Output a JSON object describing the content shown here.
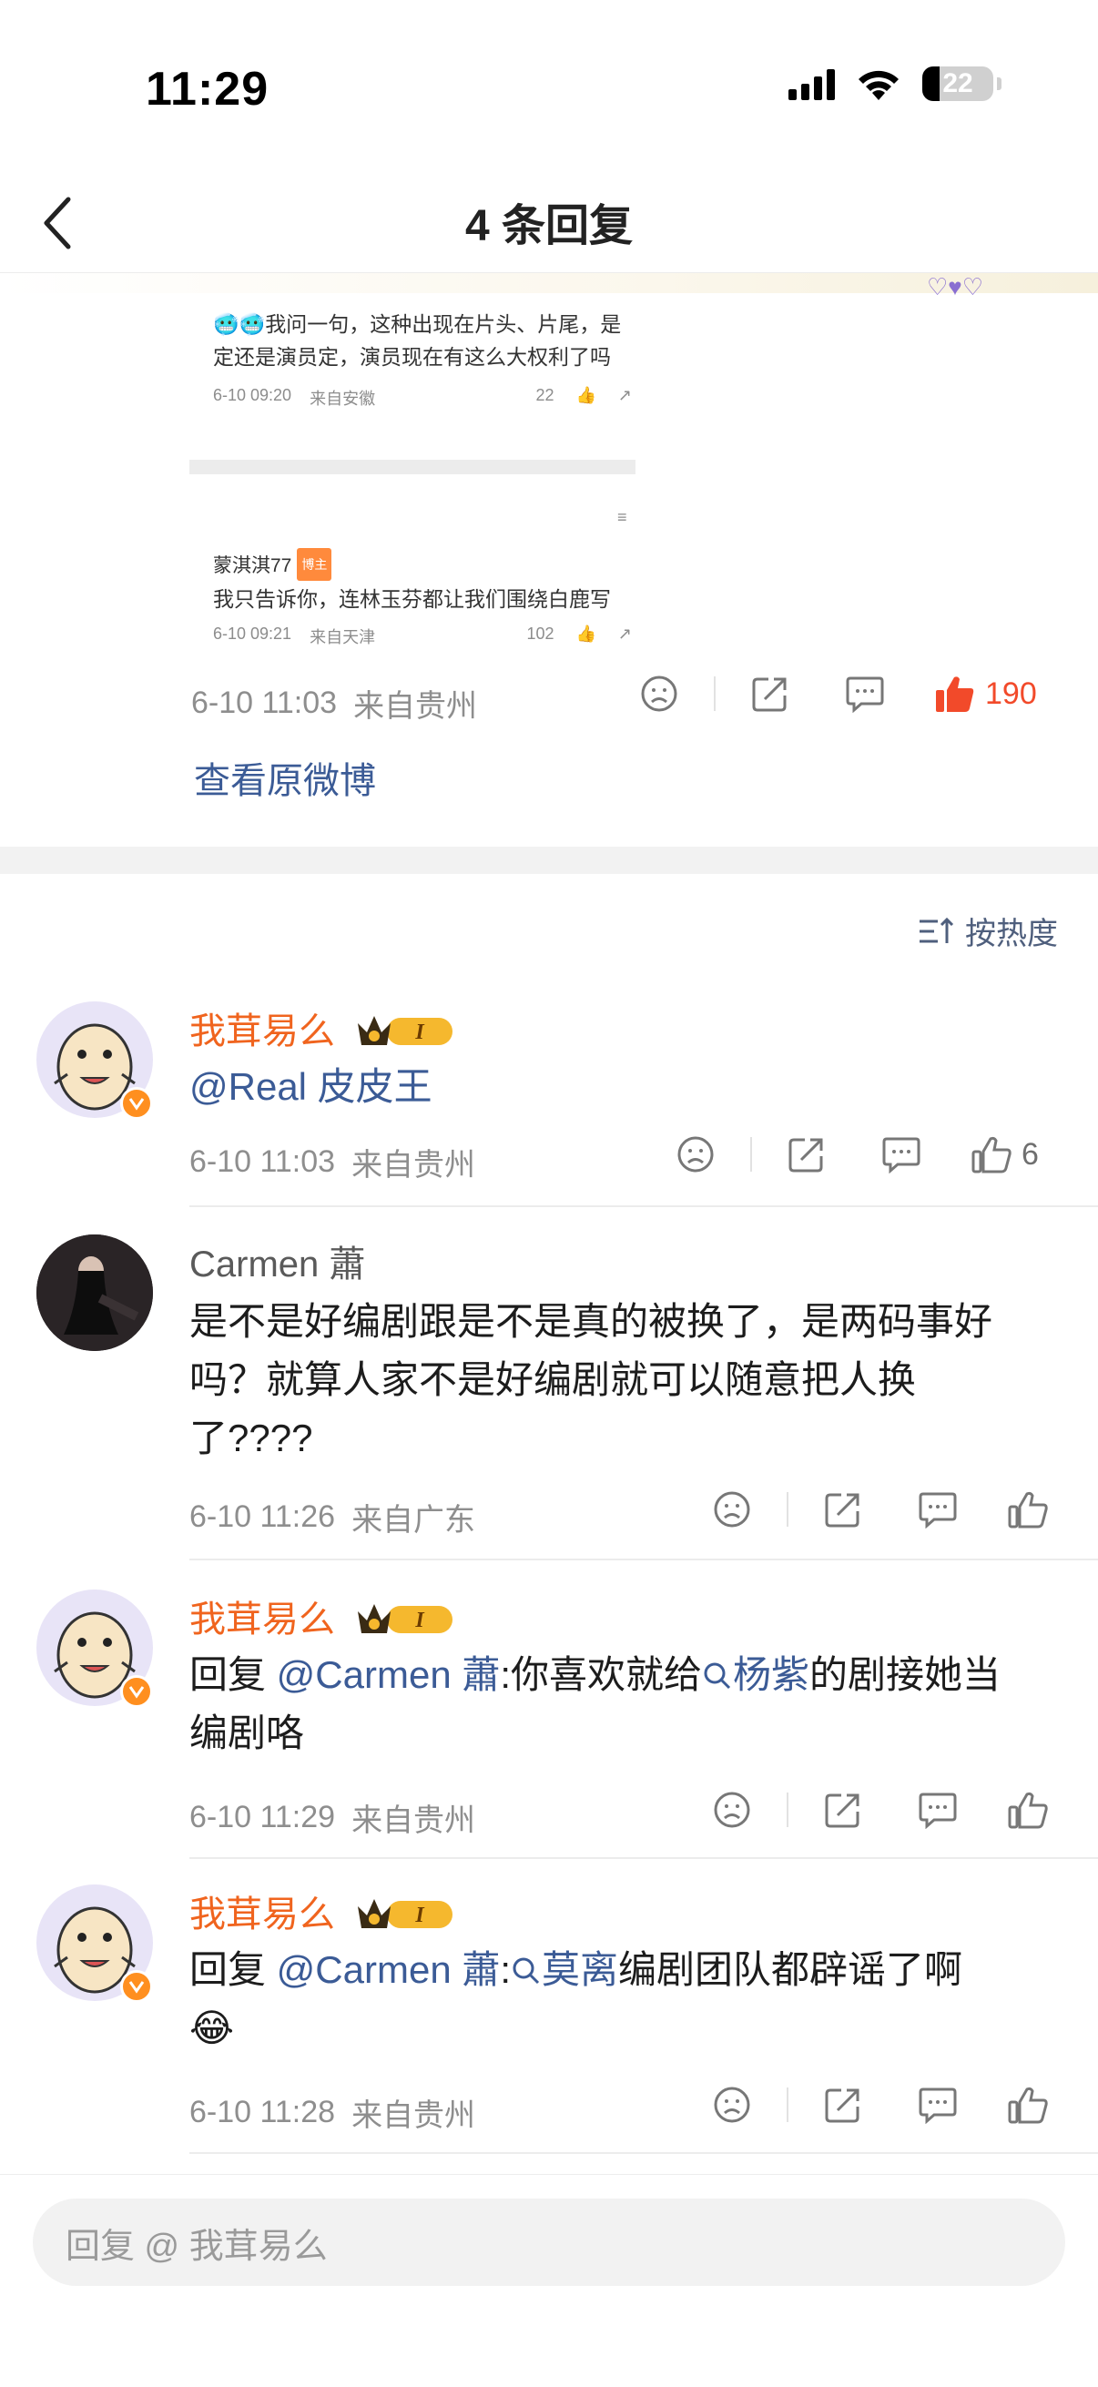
{
  "status_bar": {
    "time": "11:29",
    "battery": "22"
  },
  "nav": {
    "title": "4 条回复"
  },
  "original": {
    "screenshot": {
      "comment1": "🥶🥶我问一句，这种出现在片头、片尾，是定还是演员定，演员现在有这么大权利了吗",
      "comment1_line1": "🥶🥶我问一句，这种出现在片头、片尾，是",
      "comment1_line2": "定还是演员定，演员现在有这么大权利了吗",
      "comment1_time": "6-10 09:20",
      "comment1_loc": "来自安徽",
      "comment1_likes": "22",
      "comment2_user": "蒙淇淇77",
      "comment2_badge": "博主",
      "comment2_text": "我只告诉你，连林玉芬都让我们围绕白鹿写",
      "comment2_time": "6-10 09:21",
      "comment2_loc": "来自天津",
      "comment2_likes": "102"
    },
    "time": "6-10 11:03",
    "location": "来自贵州",
    "likes": "190",
    "view_original": "查看原微博"
  },
  "sort": {
    "label": "按热度"
  },
  "comments": [
    {
      "user": "我茸易么",
      "level": "I",
      "text_mention": "@Real 皮皮王",
      "time": "6-10 11:03",
      "location": "来自贵州",
      "likes": "6"
    },
    {
      "user": "Carmen 蕭",
      "line1": "是不是好编剧跟是不是真的被换了，是两码事好",
      "line2": "吗？就算人家不是好编剧就可以随意把人换",
      "line3": "了????",
      "time": "6-10 11:26",
      "location": "来自广东"
    },
    {
      "user": "我茸易么",
      "level": "I",
      "prefix": "回复 ",
      "mention": "@Carmen 蕭",
      "part1": ":你喜欢就给",
      "topic": "杨紫",
      "part2": "的剧接她当",
      "line2": "编剧咯",
      "time": "6-10 11:29",
      "location": "来自贵州"
    },
    {
      "user": "我茸易么",
      "level": "I",
      "prefix": "回复 ",
      "mention": "@Carmen 蕭",
      "part1": ":",
      "topic": "莫离",
      "part2": "编剧团队都辟谣了啊",
      "line2": "😂",
      "time": "6-10 11:28",
      "location": "来自贵州"
    }
  ],
  "reply_bar": {
    "placeholder": "回复 @ 我茸易么"
  },
  "colors": {
    "accent_orange": "#f0641e",
    "link_blue": "#3b5b96",
    "like_red": "#f24a2a"
  }
}
